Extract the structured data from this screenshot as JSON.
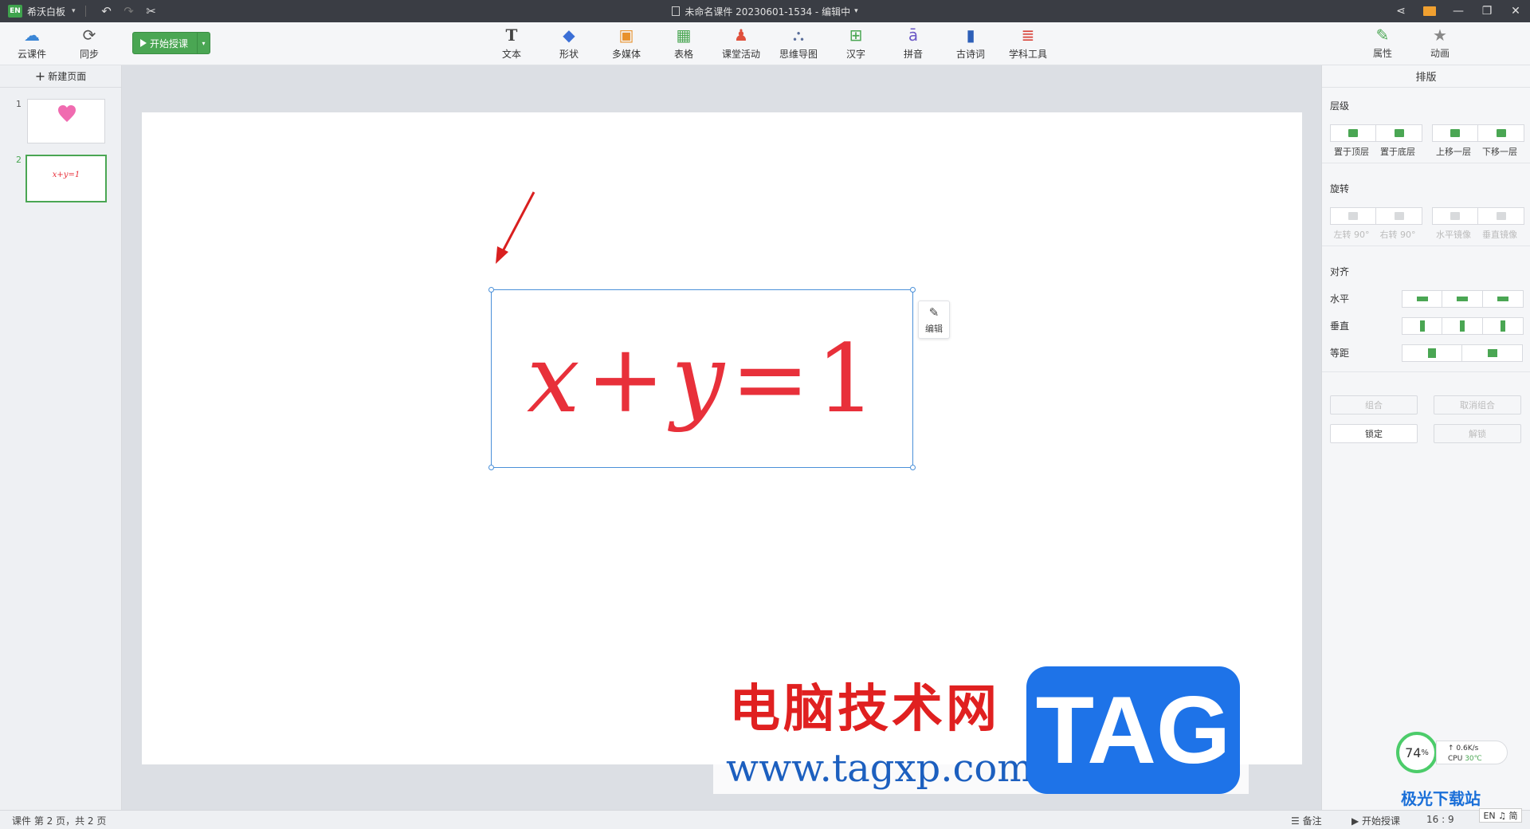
{
  "titlebar": {
    "logo_text": "EN",
    "app_name": "希沃白板",
    "document_title": "未命名课件 20230601-1534 - 编辑中"
  },
  "toolbar": {
    "cloud_label": "云课件",
    "sync_label": "同步",
    "start_class_label": "开始授课",
    "tools": [
      "文本",
      "形状",
      "多媒体",
      "表格",
      "课堂活动",
      "思维导图",
      "汉字",
      "拼音",
      "古诗词",
      "学科工具"
    ]
  },
  "left_panel": {
    "new_page_label": "新建页面",
    "pages": [
      {
        "number": "1",
        "content": "heart"
      },
      {
        "number": "2",
        "content": "x+y=1",
        "selected": true
      }
    ]
  },
  "canvas": {
    "formula": {
      "x": "x",
      "plus": "+",
      "y": "y",
      "eq": "=",
      "one": "1"
    },
    "formula_color": "#e8303a",
    "edit_label": "编辑"
  },
  "right_panel": {
    "tabs": [
      "属性",
      "动画"
    ],
    "active_tab": "属性",
    "subtitle": "排版",
    "layer": {
      "title": "层级",
      "buttons": [
        "置于顶层",
        "置于底层",
        "上移一层",
        "下移一层"
      ]
    },
    "rotate": {
      "title": "旋转",
      "buttons": [
        "左转 90°",
        "右转 90°",
        "水平镜像",
        "垂直镜像"
      ]
    },
    "align": {
      "title": "对齐",
      "horizontal": "水平",
      "vertical": "垂直",
      "spacing": "等距"
    },
    "group_label": "组合",
    "ungroup_label": "取消组合",
    "lock_label": "锁定",
    "unlock_label": "解锁"
  },
  "statusbar": {
    "page_info": "课件 第 2 页，共 2 页",
    "notes_label": "备注",
    "start_label": "开始授课",
    "ratio_label": "16 : 9"
  },
  "overlay": {
    "watermark_cn": "电脑技术网",
    "watermark_url": "www.tagxp.com",
    "watermark_tag": "TAG",
    "speed_percent": "74",
    "net_speed": "0.6K/s",
    "cpu_label": "CPU",
    "cpu_temp": "30℃",
    "site_logo": "极光下载站",
    "ime_label": "EN ♫ 简"
  },
  "colors": {
    "accent": "#4aa653",
    "selection": "#4a90d9",
    "titlebar_bg": "#3a3d44"
  }
}
